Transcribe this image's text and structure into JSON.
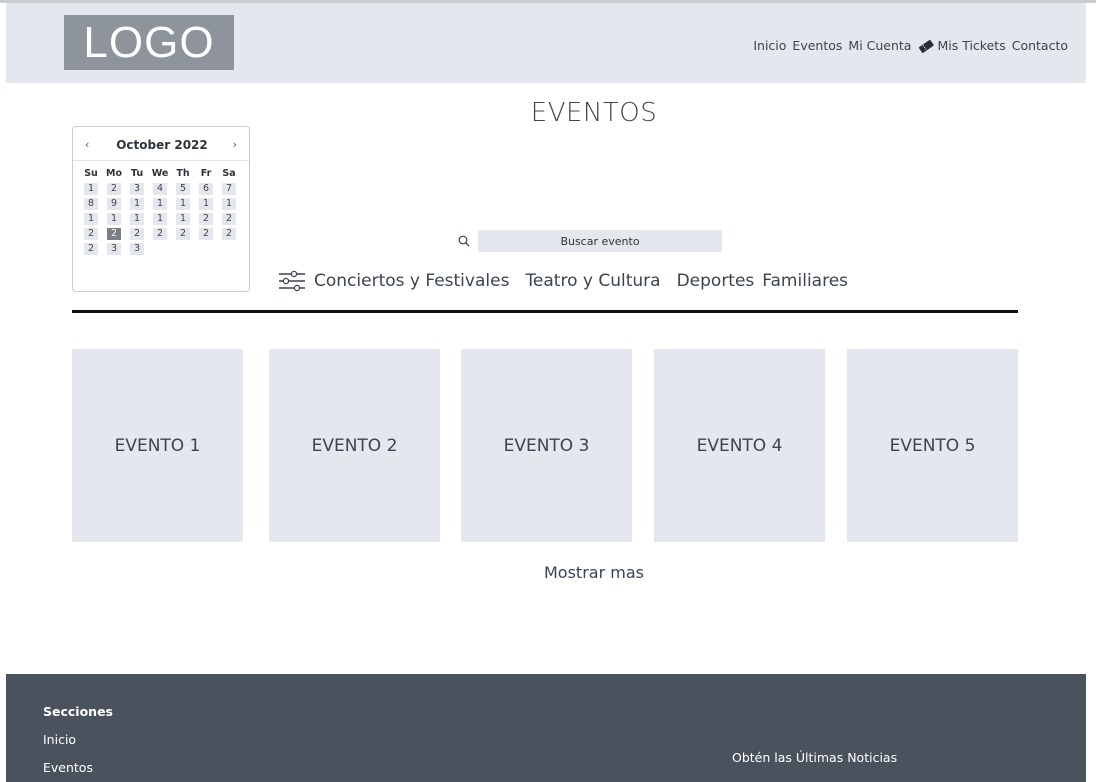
{
  "header": {
    "logo": "LOGO",
    "nav": [
      {
        "label": "Inicio"
      },
      {
        "label": "Eventos"
      },
      {
        "label": "Mi Cuenta"
      },
      {
        "label": "Mis Tickets",
        "icon": "ticket-icon"
      },
      {
        "label": "Contacto"
      }
    ]
  },
  "main": {
    "title": "EVENTOS",
    "calendar": {
      "month_label": "October 2022",
      "prev": "‹",
      "next": "›",
      "weekdays": [
        "Su",
        "Mo",
        "Tu",
        "We",
        "Th",
        "Fr",
        "Sa"
      ],
      "days": [
        "1",
        "2",
        "3",
        "4",
        "5",
        "6",
        "7",
        "8",
        "9",
        "1",
        "1",
        "1",
        "1",
        "1",
        "1",
        "1",
        "1",
        "1",
        "1",
        "2",
        "2",
        "2",
        "2",
        "2",
        "2",
        "2",
        "2",
        "2",
        "2",
        "3",
        "3"
      ],
      "selected_index": 22
    },
    "search": {
      "placeholder": "Buscar evento",
      "icon": "search-icon"
    },
    "categories": [
      {
        "label": "Conciertos y Festivales"
      },
      {
        "label": "Teatro y Cultura"
      },
      {
        "label": "Deportes"
      },
      {
        "label": "Familiares"
      }
    ],
    "events": [
      {
        "label": "EVENTO 1"
      },
      {
        "label": "EVENTO 2"
      },
      {
        "label": "EVENTO 3"
      },
      {
        "label": "EVENTO 4"
      },
      {
        "label": "EVENTO 5"
      }
    ],
    "show_more": "Mostrar mas"
  },
  "footer": {
    "sections_title": "Secciones",
    "links": [
      {
        "label": "Inicio"
      },
      {
        "label": "Eventos"
      }
    ],
    "newsletter": "Obtén las Últimas Noticias"
  },
  "colors": {
    "header_bg": "#e4e7ee",
    "logo_bg": "#8e949b",
    "footer_bg": "#4a525d",
    "card_bg": "#e4e7ee",
    "text": "#3b4450",
    "selected_day": "#7a7f86"
  }
}
